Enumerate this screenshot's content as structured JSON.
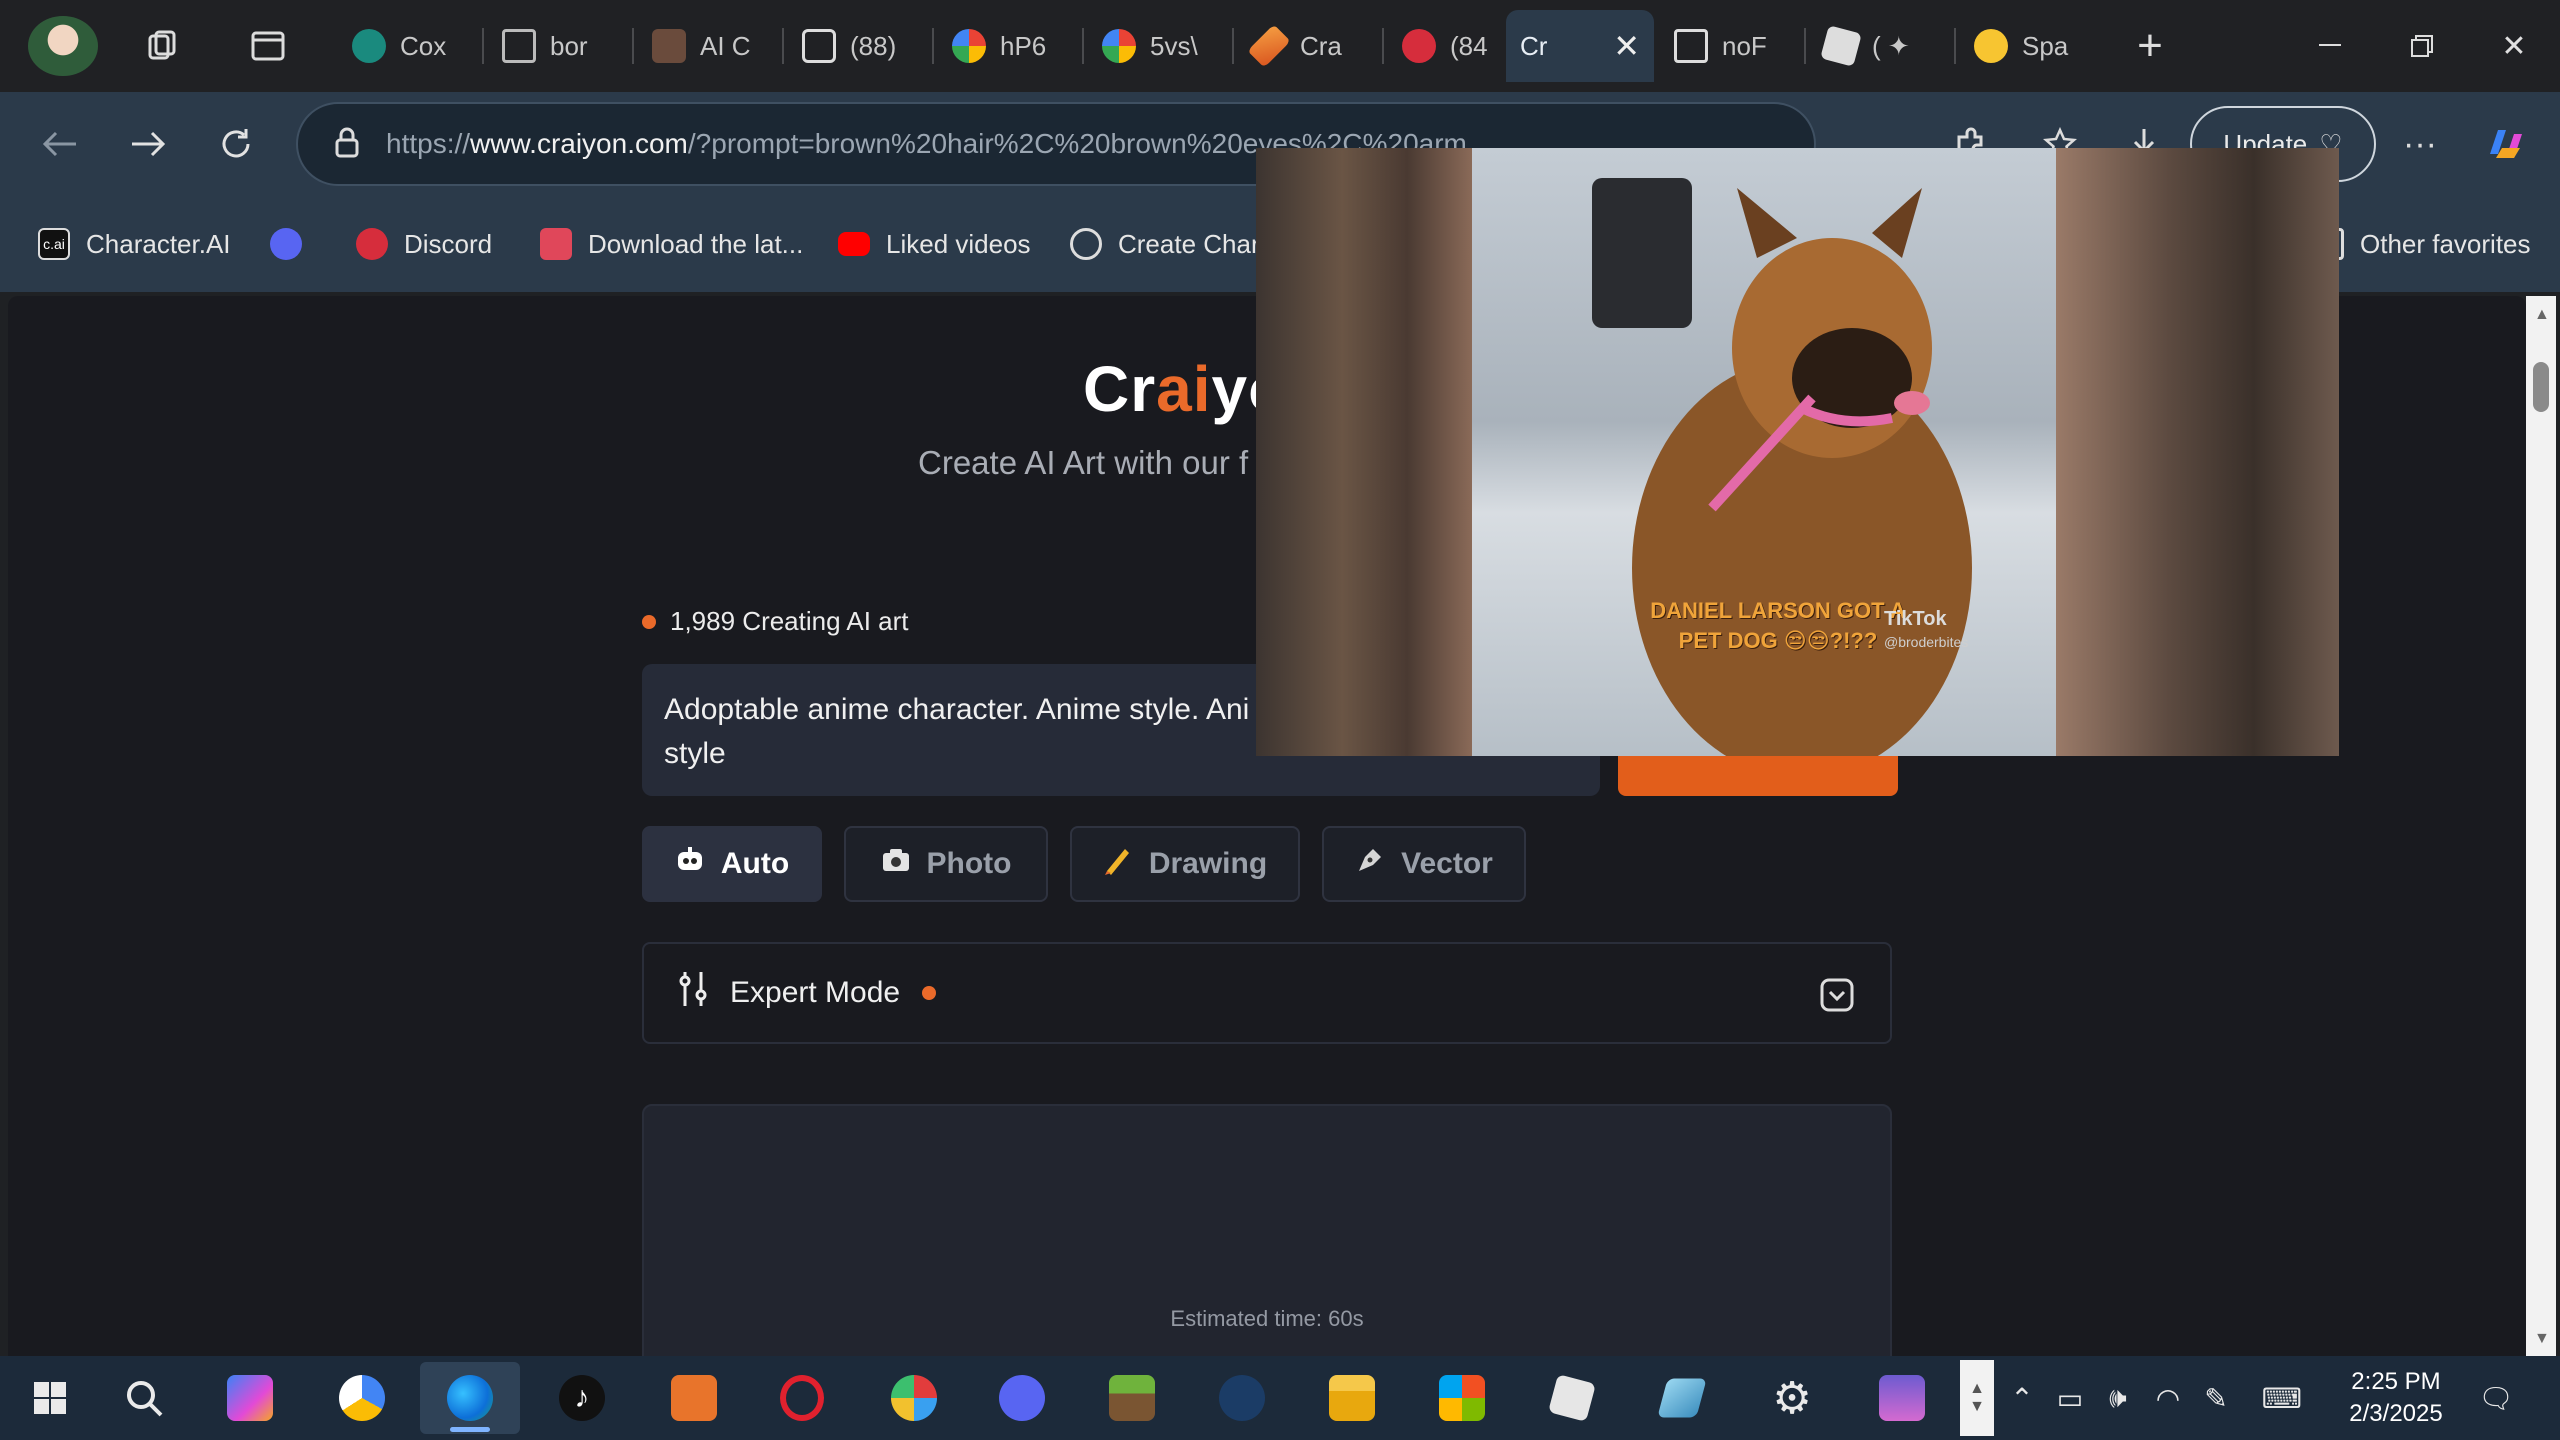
{
  "tabs": [
    {
      "title": "Cox",
      "icon": "teal-circle-icon"
    },
    {
      "title": "bor",
      "icon": "document-icon"
    },
    {
      "title": "AI C",
      "icon": "image-thumb-icon"
    },
    {
      "title": "(88)",
      "icon": "picture-frame-icon"
    },
    {
      "title": "hP6",
      "icon": "pinwheel-icon"
    },
    {
      "title": "5vs\\",
      "icon": "pinwheel-icon"
    },
    {
      "title": "Cra",
      "icon": "pencil-icon"
    },
    {
      "title": "(84",
      "icon": "badge-8k-icon"
    },
    {
      "title": "Cr",
      "icon": "none",
      "active": true
    },
    {
      "title": "noF",
      "icon": "document-icon"
    },
    {
      "title": "( ✦",
      "icon": "roblox-icon"
    },
    {
      "title": "Spa",
      "icon": "emoji-icon"
    }
  ],
  "address": {
    "prefix": "https://",
    "host": "www.craiyon.com",
    "path": "/?prompt=brown%20hair%2C%20brown%20eyes%2C%20arm"
  },
  "update_label": "Update",
  "favorites": [
    {
      "label": "Character.AI",
      "icon": "cai-icon"
    },
    {
      "label": "",
      "icon": "discord-icon"
    },
    {
      "label": "Discord",
      "icon": "badge-8k-icon"
    },
    {
      "label": "Download the lat...",
      "icon": "store-icon"
    },
    {
      "label": "Liked videos",
      "icon": "youtube-icon"
    },
    {
      "label": "Create Charac",
      "icon": "openai-icon"
    }
  ],
  "other_favorites": "Other favorites",
  "page": {
    "brand": {
      "pre": "Cr",
      "ai": "ai",
      "post": "yo"
    },
    "tagline": "Create AI Art with our f",
    "live_count": "1,989 Creating AI art",
    "prompt_text": "Adoptable anime character. Anime style. Ani Beloved. gif. in anime style",
    "modes": [
      {
        "label": "Auto",
        "icon": "robot-icon",
        "active": true
      },
      {
        "label": "Photo",
        "icon": "camera-icon"
      },
      {
        "label": "Drawing",
        "icon": "pencil-icon"
      },
      {
        "label": "Vector",
        "icon": "pen-nib-icon"
      }
    ],
    "expert_mode_label": "Expert Mode",
    "estimated_time": "Estimated time: 60s"
  },
  "pip_video": {
    "caption": "DANIEL LARSON GOT A PET DOG 😒😒?!??",
    "brand": "TikTok",
    "handle": "@broderbites"
  },
  "taskbar": {
    "apps": [
      "start-icon",
      "search-icon",
      "copilot-icon",
      "chrome-like-icon",
      "edge-icon",
      "tiktok-icon",
      "cursor-app-icon",
      "opera-icon",
      "paint-icon",
      "discord-icon",
      "minecraft-icon",
      "steam-icon",
      "file-explorer-icon",
      "store-icon",
      "roblox-icon",
      "snip-icon",
      "settings-icon",
      "anime-app-icon"
    ],
    "time": "2:25 PM",
    "date": "2/3/2025"
  }
}
